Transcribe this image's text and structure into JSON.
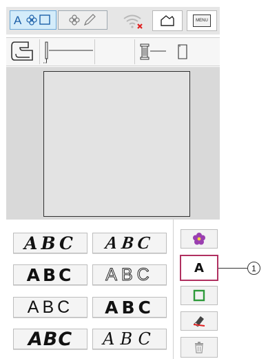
{
  "toolbar": {
    "tabs": [
      {
        "name": "text-edit-tab",
        "icon": "letter-a-flower-frame-icon",
        "glyph": "A❀☐",
        "active": true
      },
      {
        "name": "embroidery-edit-tab",
        "icon": "flower-pencil-icon",
        "glyph": "❀✎",
        "active": false
      }
    ],
    "wifi_icon": "wifi-disconnected-icon",
    "buttons": [
      {
        "name": "print-fabric-button",
        "icon": "fabric-outline-icon"
      },
      {
        "name": "menu-button",
        "icon": "menu-icon",
        "label": "MENU"
      }
    ]
  },
  "info_bar": {
    "presser_foot_icon": "presser-foot-icon",
    "needle_icon": "needle-icon",
    "bobbin_icon": "thread-spool-icon",
    "fabric_icon": "fabric-sheet-icon"
  },
  "fonts": [
    {
      "name": "font-1",
      "sample": "ABC",
      "style": "bold-italic-serif"
    },
    {
      "name": "font-2",
      "sample": "ABC",
      "style": "bold-italic-script"
    },
    {
      "name": "font-3",
      "sample": "ABC",
      "style": "heavy-rounded"
    },
    {
      "name": "font-4",
      "sample": "ABC",
      "style": "outline"
    },
    {
      "name": "font-5",
      "sample": "ABC",
      "style": "light-sans"
    },
    {
      "name": "font-6",
      "sample": "ABC",
      "style": "black-sans"
    },
    {
      "name": "font-7",
      "sample": "ABC",
      "style": "heavy-italic"
    },
    {
      "name": "font-8",
      "sample": "ABC",
      "style": "thin-script"
    }
  ],
  "tools": [
    {
      "name": "embroidery-pattern-button",
      "icon": "flower-icon",
      "selected": false
    },
    {
      "name": "character-button",
      "label": "A",
      "icon": "letter-a-icon",
      "selected": true
    },
    {
      "name": "frame-pattern-button",
      "icon": "square-frame-icon",
      "selected": false
    },
    {
      "name": "eraser-button",
      "icon": "eraser-icon",
      "selected": false
    },
    {
      "name": "delete-button",
      "icon": "trash-icon",
      "selected": false
    }
  ],
  "callout": {
    "label": "1"
  },
  "colors": {
    "selected_border": "#b03060",
    "flower": "#9a3fb0",
    "frame": "#2e9a3a",
    "wifi_x": "#e02020"
  }
}
